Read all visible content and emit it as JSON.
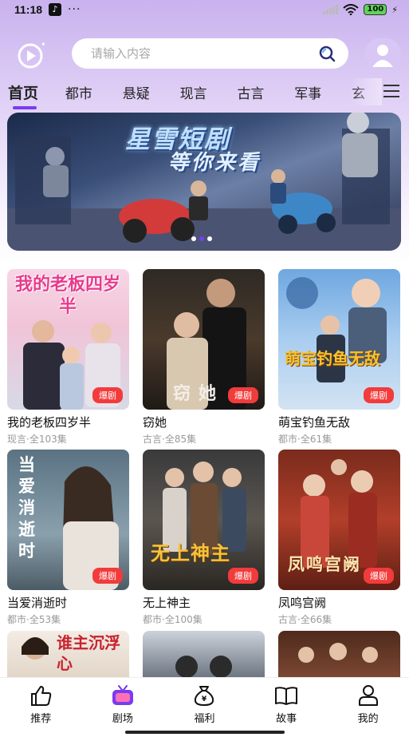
{
  "status_bar": {
    "time": "11:18",
    "dots": "···",
    "battery": "100",
    "icons": [
      "tiktok-icon",
      "signal-icon",
      "wifi-icon",
      "battery-icon",
      "charging-icon"
    ]
  },
  "search": {
    "placeholder": "请输入内容"
  },
  "tabs": [
    {
      "label": "首页",
      "active": true
    },
    {
      "label": "都市"
    },
    {
      "label": "悬疑"
    },
    {
      "label": "现言"
    },
    {
      "label": "古言"
    },
    {
      "label": "军事"
    },
    {
      "label": "玄"
    }
  ],
  "banner": {
    "title": "星雪短剧",
    "subtitle": "等你来看"
  },
  "dramas": [
    {
      "title": "我的老板四岁半",
      "meta": "现言·全103集",
      "badge": "爆剧",
      "poster_text": "我的老板四岁半"
    },
    {
      "title": "窃她",
      "meta": "古言·全85集",
      "badge": "爆剧",
      "poster_text": "窃她"
    },
    {
      "title": "萌宝钓鱼无敌",
      "meta": "都市·全61集",
      "badge": "爆剧",
      "poster_text": "萌宝钓鱼无敌"
    },
    {
      "title": "当爱消逝时",
      "meta": "都市·全53集",
      "badge": "爆剧",
      "poster_text": "当爱消逝时"
    },
    {
      "title": "无上神主",
      "meta": "都市·全100集",
      "badge": "爆剧",
      "poster_text": "无上神主"
    },
    {
      "title": "凤鸣宫阙",
      "meta": "古言·全66集",
      "badge": "爆剧",
      "poster_text": "凤鸣宫阙"
    },
    {
      "poster_text": "谁主沉浮心"
    },
    {},
    {}
  ],
  "bottom_nav": [
    {
      "label": "推荐",
      "icon": "thumbs-up-icon"
    },
    {
      "label": "剧场",
      "icon": "tv-icon",
      "active": true
    },
    {
      "label": "福利",
      "icon": "money-bag-icon"
    },
    {
      "label": "故事",
      "icon": "book-icon"
    },
    {
      "label": "我的",
      "icon": "person-icon"
    }
  ],
  "colors": {
    "accent": "#7a3cf0",
    "badge": "#f23b3b"
  }
}
